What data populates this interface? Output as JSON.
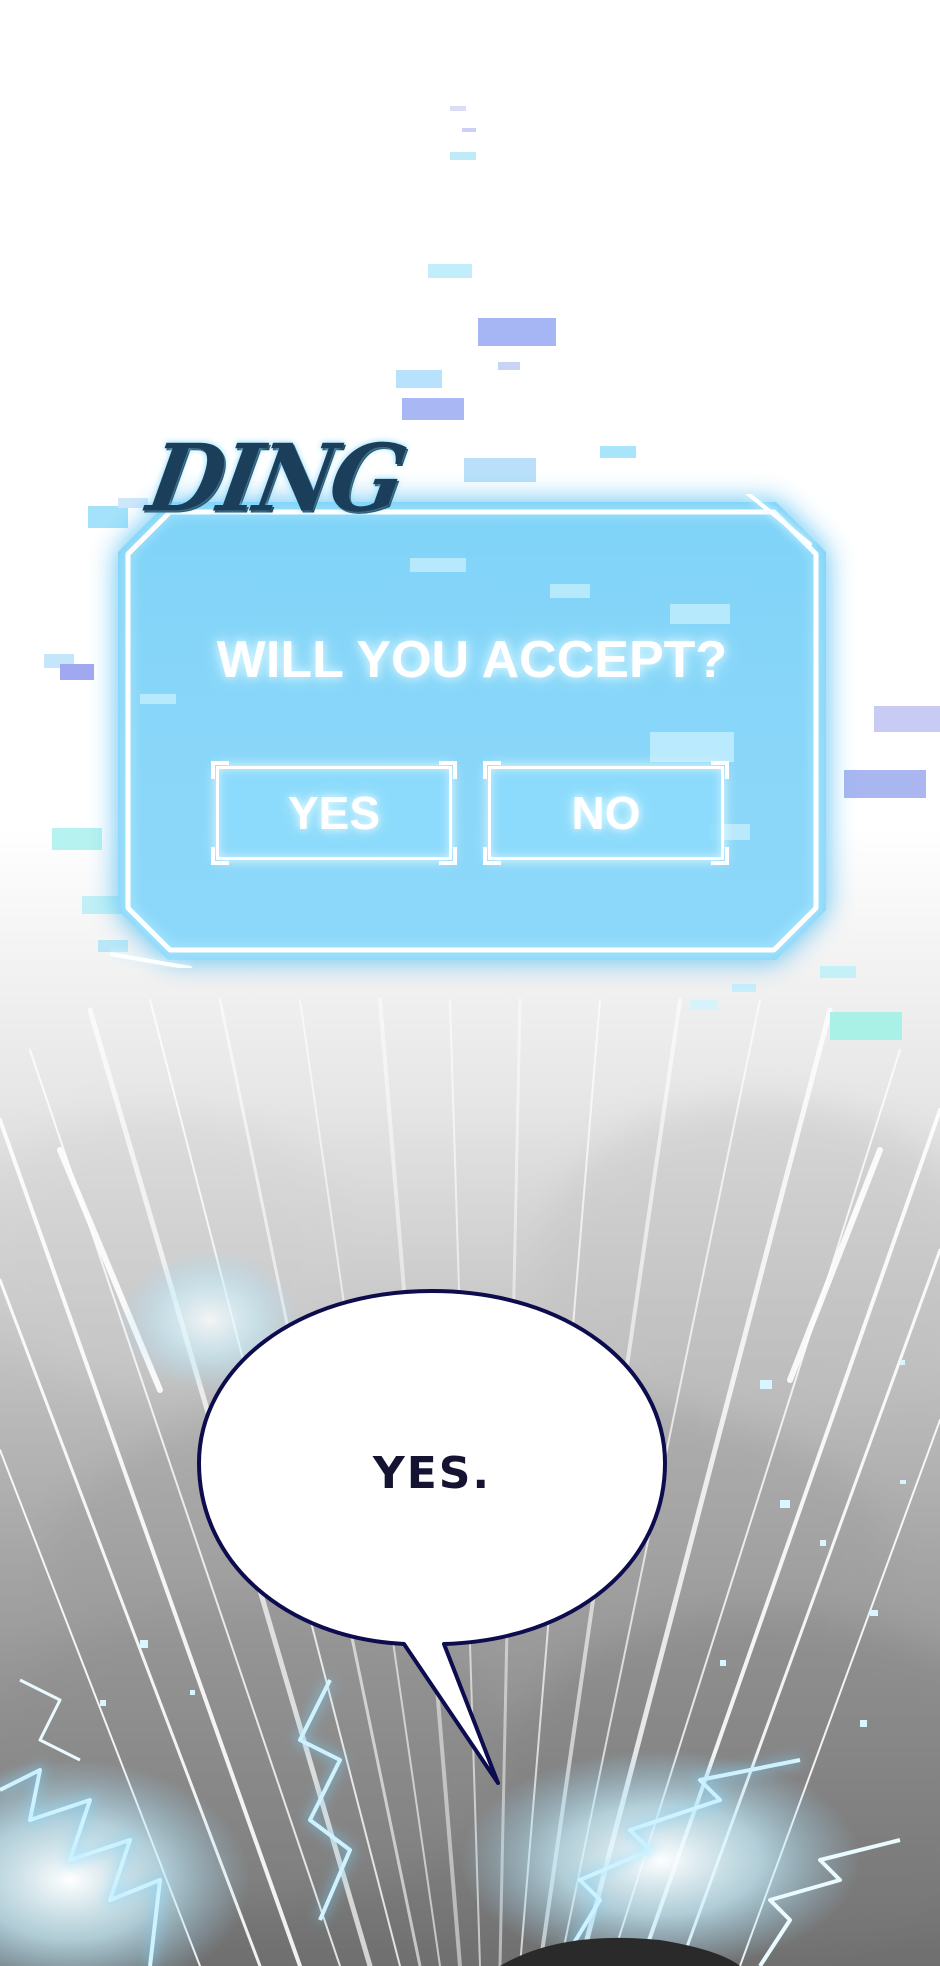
{
  "sound_effect": "DING",
  "system_window": {
    "question": "WILL YOU ACCEPT?",
    "yes_label": "YES",
    "no_label": "NO"
  },
  "speech_bubble": {
    "text": "YES."
  },
  "colors": {
    "window_fill": "#8dd8fa",
    "window_glow": "#4fc3f7",
    "frame_line": "#ffffff",
    "bubble_outline": "#0c0c4e",
    "speech_text": "#141432",
    "sfx_text": "#1b3f5a"
  },
  "icons": [
    "glitch-pixel-icon",
    "lightning-icon"
  ]
}
